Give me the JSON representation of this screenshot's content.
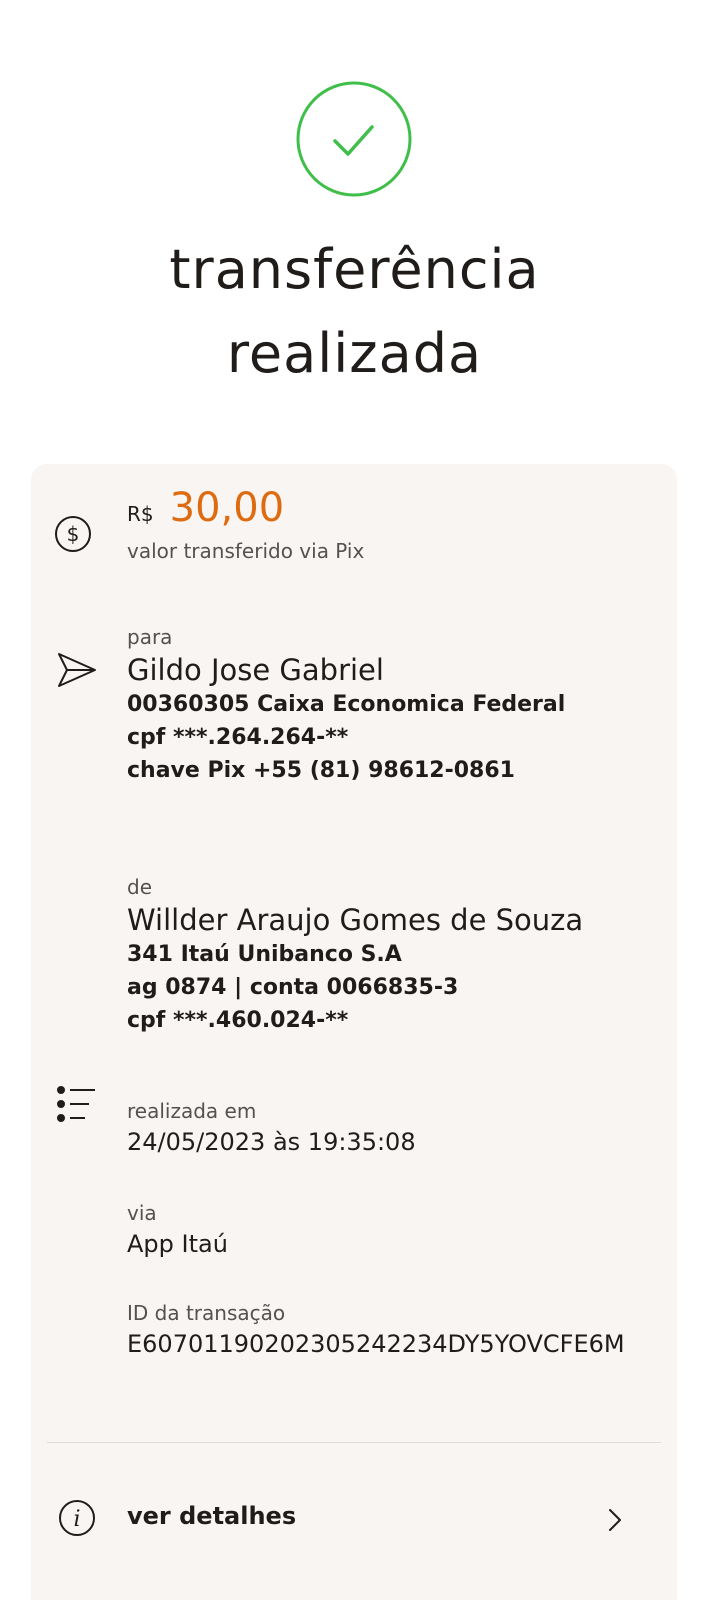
{
  "header": {
    "title_line1": "transferência",
    "title_line2": "realizada",
    "success_color": "#3fbf4a",
    "icon": "check-circle-icon"
  },
  "amount": {
    "currency": "R$",
    "value": "30,00",
    "label": "valor transferido via Pix",
    "accent_color": "#df6b11",
    "icon": "dollar-circle-icon"
  },
  "recipient": {
    "label": "para",
    "name": "Gildo Jose Gabriel",
    "bank": "00360305 Caixa Economica Federal",
    "cpf": "cpf ***.264.264-**",
    "pix_key": "chave Pix +55 (81) 98612-0861",
    "icon": "send-icon"
  },
  "sender": {
    "label": "de",
    "name": "Willder Araujo Gomes de Souza",
    "bank": "341 Itaú Unibanco S.A",
    "account": "ag 0874 | conta 0066835-3",
    "cpf": "cpf ***.460.024-**"
  },
  "transaction": {
    "date_label": "realizada em",
    "date_value": "24/05/2023 às 19:35:08",
    "channel_label": "via",
    "channel_value": "App Itaú",
    "id_label": "ID da transação",
    "id_value": "E60701190202305242234DY5YOVCFE6M",
    "icon": "list-icon"
  },
  "footer": {
    "details_label": "ver detalhes",
    "info_icon": "info-icon",
    "chevron_icon": "chevron-right-icon"
  }
}
